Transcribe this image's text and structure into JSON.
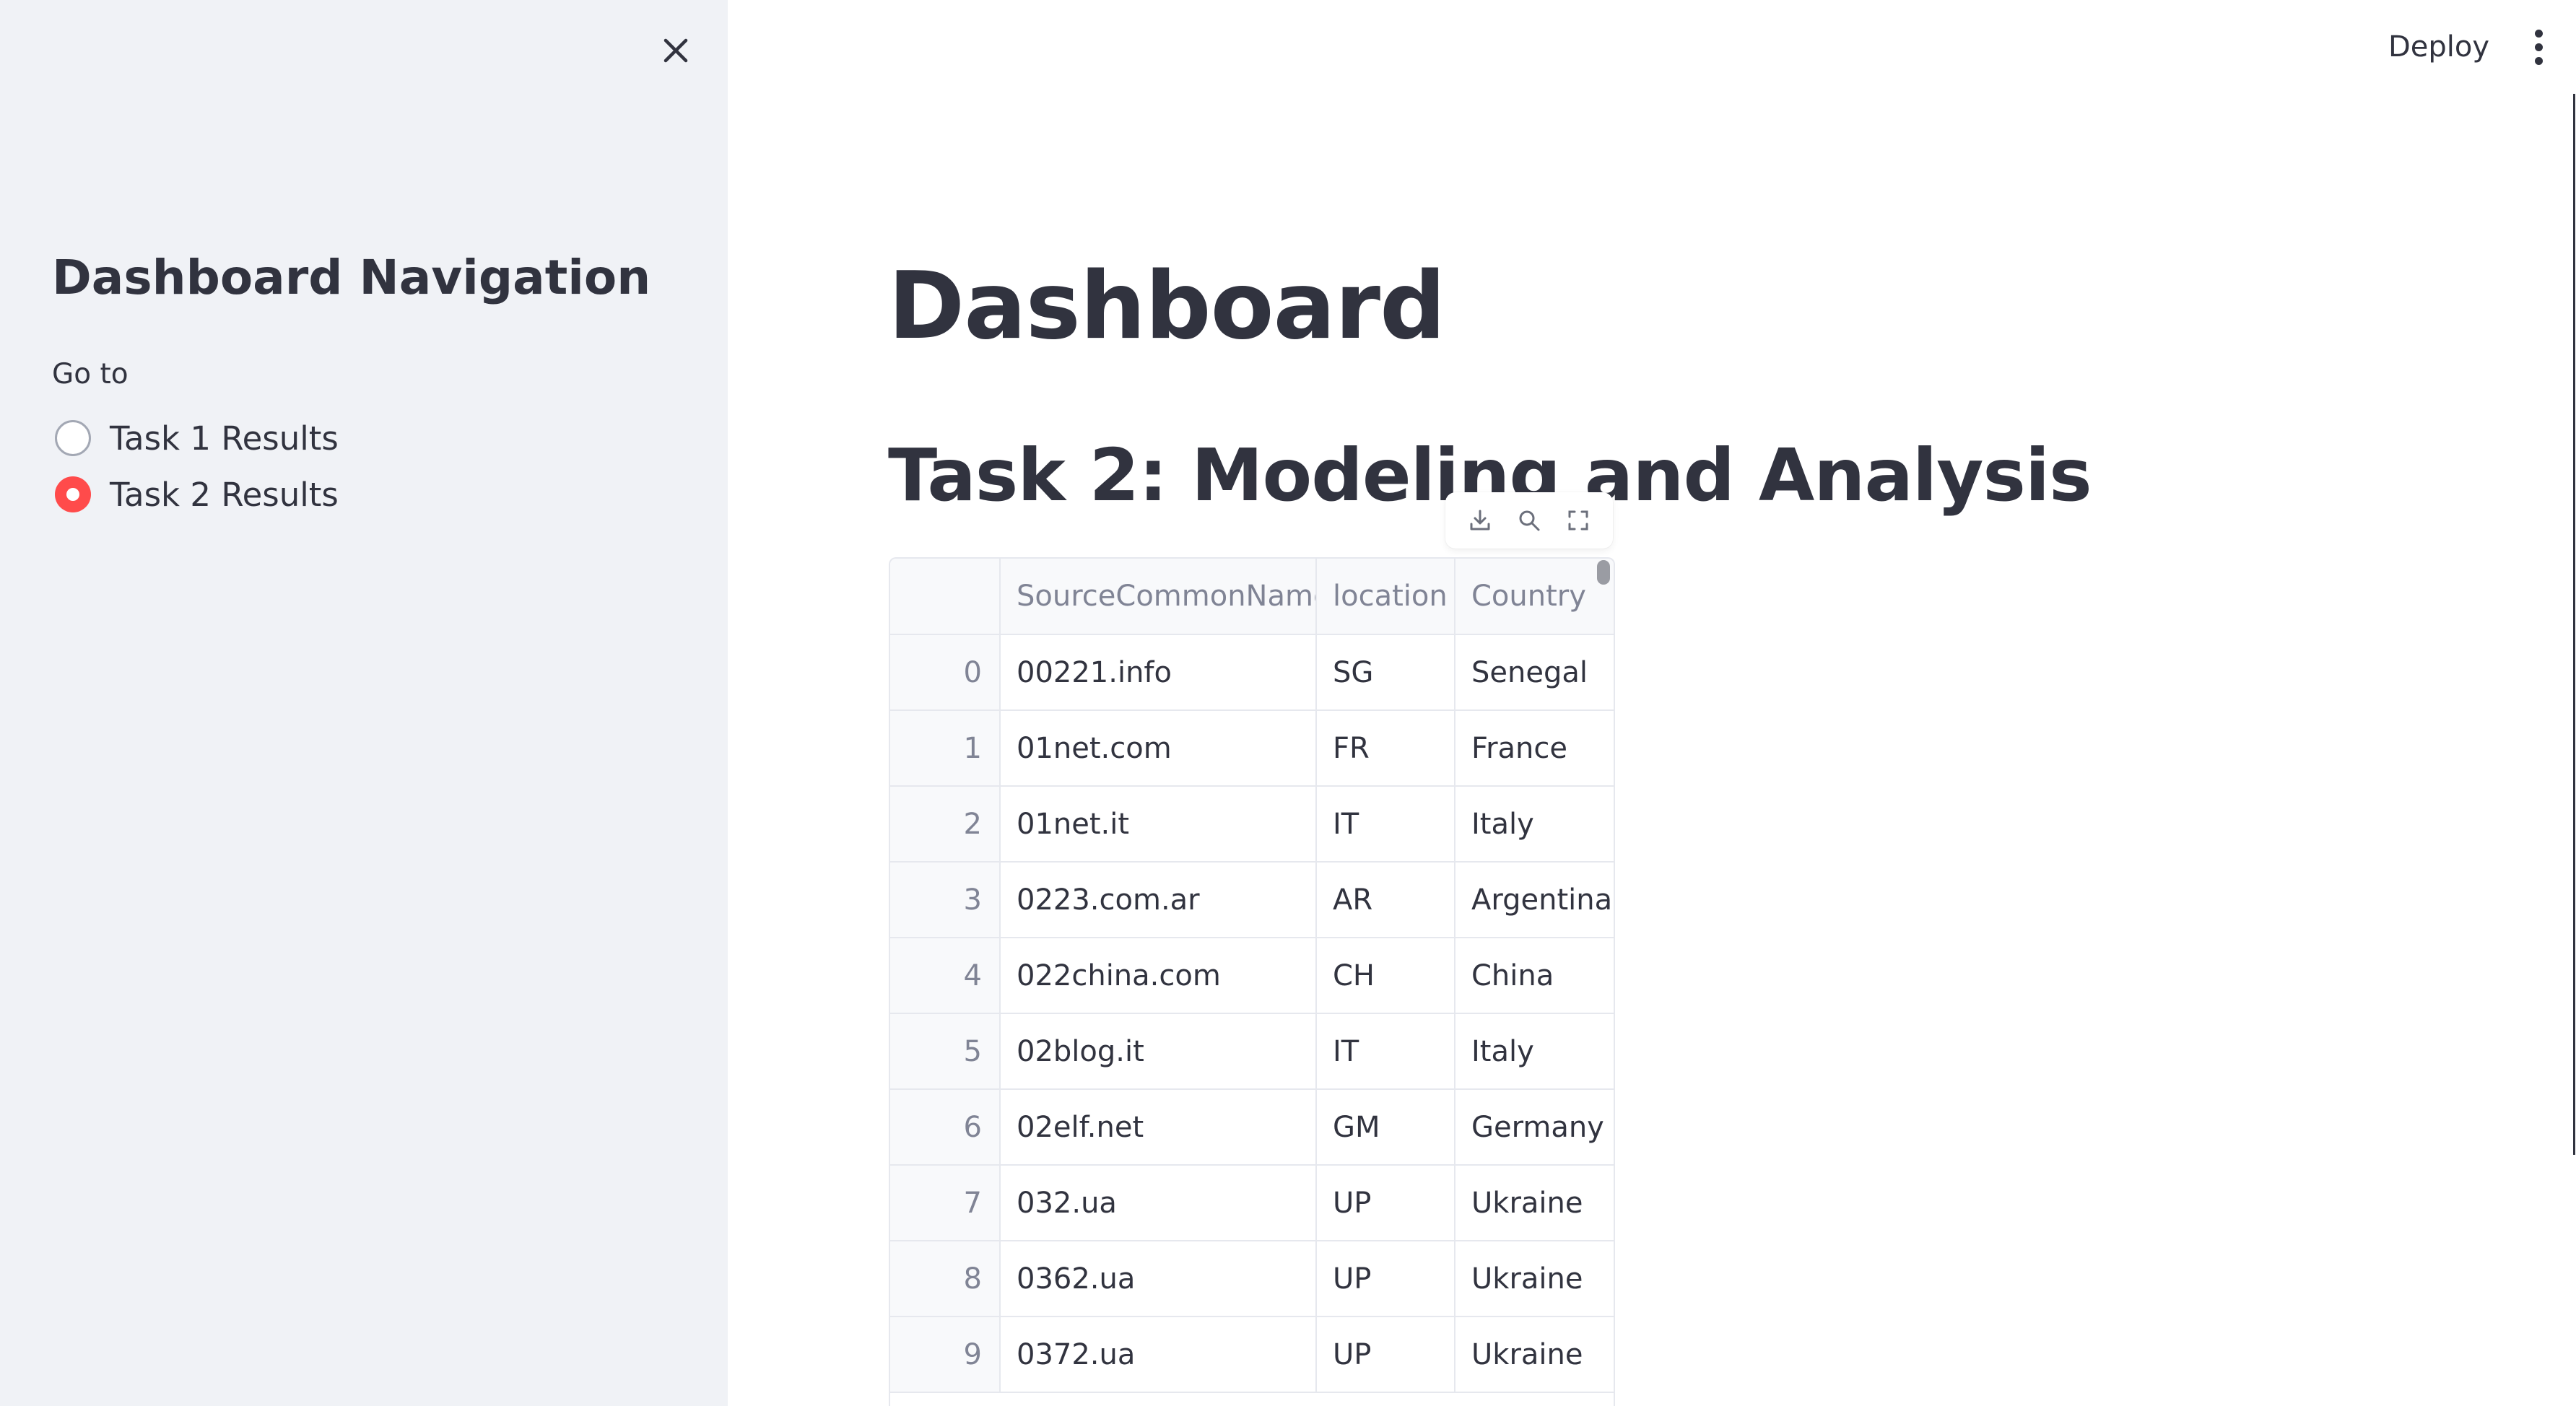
{
  "sidebar": {
    "title": "Dashboard Navigation",
    "radio_label": "Go to",
    "options": [
      {
        "label": "Task 1 Results",
        "selected": false
      },
      {
        "label": "Task 2 Results",
        "selected": true
      }
    ]
  },
  "header": {
    "deploy_label": "Deploy"
  },
  "main": {
    "title": "Dashboard",
    "section_title": "Task 2: Modeling and Analysis"
  },
  "dataframe": {
    "columns": [
      "",
      "SourceCommonName",
      "location",
      "Country"
    ],
    "rows": [
      {
        "index": "0",
        "SourceCommonName": "00221.info",
        "location": "SG",
        "Country": "Senegal"
      },
      {
        "index": "1",
        "SourceCommonName": "01net.com",
        "location": "FR",
        "Country": "France"
      },
      {
        "index": "2",
        "SourceCommonName": "01net.it",
        "location": "IT",
        "Country": "Italy"
      },
      {
        "index": "3",
        "SourceCommonName": "0223.com.ar",
        "location": "AR",
        "Country": "Argentina"
      },
      {
        "index": "4",
        "SourceCommonName": "022china.com",
        "location": "CH",
        "Country": "China"
      },
      {
        "index": "5",
        "SourceCommonName": "02blog.it",
        "location": "IT",
        "Country": "Italy"
      },
      {
        "index": "6",
        "SourceCommonName": "02elf.net",
        "location": "GM",
        "Country": "Germany"
      },
      {
        "index": "7",
        "SourceCommonName": "032.ua",
        "location": "UP",
        "Country": "Ukraine"
      },
      {
        "index": "8",
        "SourceCommonName": "0362.ua",
        "location": "UP",
        "Country": "Ukraine"
      },
      {
        "index": "9",
        "SourceCommonName": "0372.ua",
        "location": "UP",
        "Country": "Ukraine"
      }
    ],
    "toolbar_icons": [
      "download-icon",
      "search-icon",
      "fullscreen-icon"
    ]
  },
  "colors": {
    "accent": "#ff4b4b",
    "sidebar_bg": "#f0f2f6",
    "text": "#31333f",
    "muted": "#808495"
  }
}
